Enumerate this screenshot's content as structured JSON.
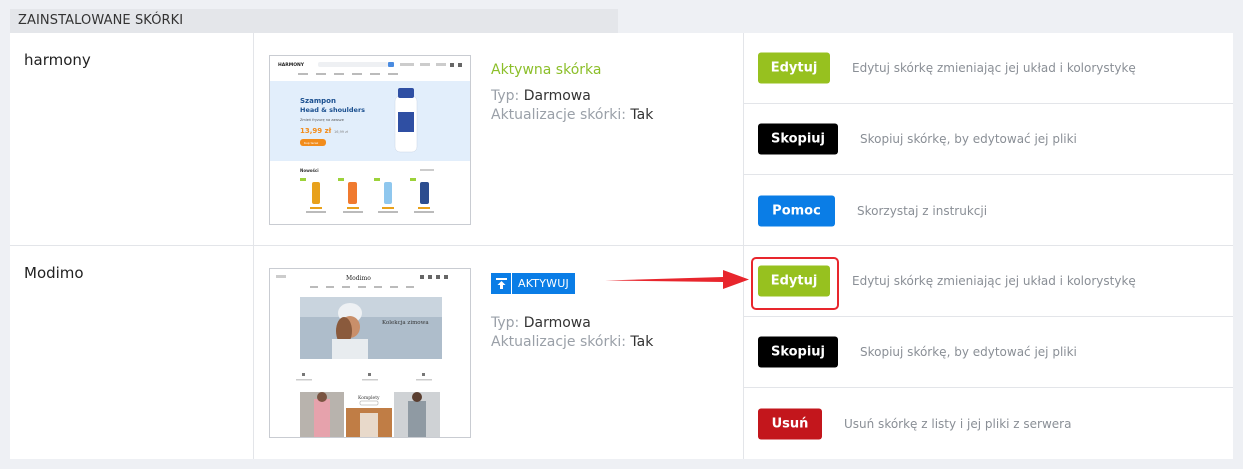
{
  "section_header": "ZAINSTALOWANE SKÓRKI",
  "skins": [
    {
      "name": "harmony",
      "status": "Aktywna skórka",
      "type_key": "Typ:",
      "type_val": "Darmowa",
      "updates_key": "Aktualizacje skórki:",
      "updates_val": "Tak",
      "preview": {
        "logo": "HARMONY",
        "hero_title1": "Szampon",
        "hero_title2": "Head & shoulders",
        "hero_sub": "Zmień fryzurę na zawsze",
        "price": "13,99 zł",
        "old_price": "16,99 zł",
        "cta": "Kup teraz",
        "section_title": "Nowości"
      },
      "actions": [
        {
          "label": "Edytuj",
          "desc": "Edytuj skórkę zmieniając jej układ i kolorystykę",
          "color": "#97c11f"
        },
        {
          "label": "Skopiuj",
          "desc": "Skopiuj skórkę, by edytować jej pliki",
          "color": "#000000"
        },
        {
          "label": "Pomoc",
          "desc": "Skorzystaj z instrukcji",
          "color": "#0a7de6"
        }
      ]
    },
    {
      "name": "Modimo",
      "activate_label": "AKTYWUJ",
      "type_key": "Typ:",
      "type_val": "Darmowa",
      "updates_key": "Aktualizacje skórki:",
      "updates_val": "Tak",
      "preview": {
        "logo": "Modimo",
        "hero_text": "Kolekcja zimowa",
        "section_title": "Komplety"
      },
      "actions": [
        {
          "label": "Edytuj",
          "desc": "Edytuj skórkę zmieniając jej układ i kolorystykę",
          "color": "#97c11f"
        },
        {
          "label": "Skopiuj",
          "desc": "Skopiuj skórkę, by edytować jej pliki",
          "color": "#000000"
        },
        {
          "label": "Usuń",
          "desc": "Usuń skórkę z listy i jej pliki z serwera",
          "color": "#c3161c"
        }
      ]
    }
  ],
  "annotation": {
    "arrow_color": "#e8262d",
    "highlight_color": "#e8262d"
  }
}
